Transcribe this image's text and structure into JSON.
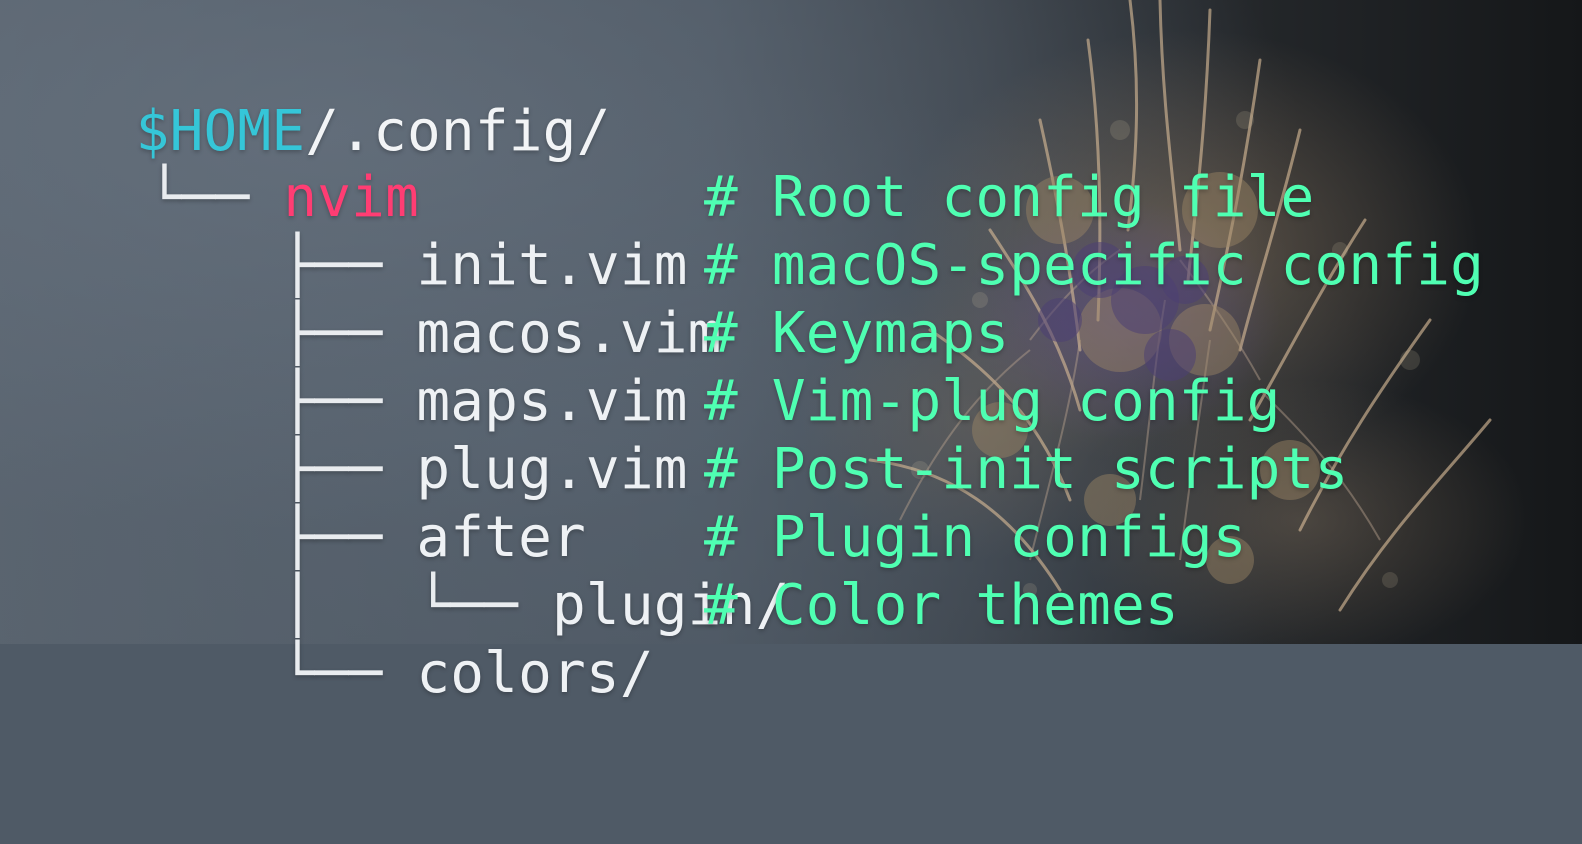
{
  "tree": {
    "root": {
      "home_var": "$HOME",
      "path_suffix": "/.config/"
    },
    "nvim": {
      "branch": "└── ",
      "name": "nvim"
    },
    "items": [
      {
        "branch": "├── ",
        "name": "init.vim",
        "comment": "# Root config file"
      },
      {
        "branch": "├── ",
        "name": "macos.vim",
        "comment": "# macOS-specific config"
      },
      {
        "branch": "├── ",
        "name": "maps.vim",
        "comment": "# Keymaps"
      },
      {
        "branch": "├── ",
        "name": "plug.vim",
        "comment": "# Vim-plug config"
      },
      {
        "branch": "├── ",
        "name": "after",
        "comment": "# Post-init scripts"
      },
      {
        "branch": "│   └── ",
        "name": "plugin/",
        "comment": "# Plugin configs"
      },
      {
        "branch": "└── ",
        "name": "colors/",
        "comment": "# Color themes"
      }
    ]
  },
  "colors": {
    "home_var": "#35c6d8",
    "nvim": "#ff3d73",
    "comment": "#4fffb2",
    "text": "#eef1f4"
  }
}
